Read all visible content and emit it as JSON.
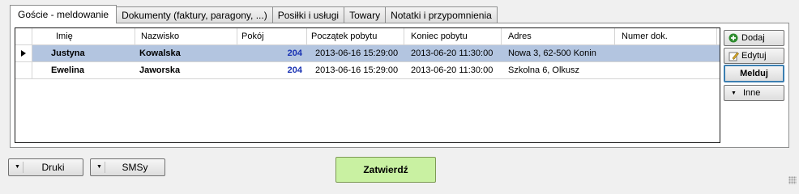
{
  "tabs": [
    {
      "label": "Goście - meldowanie"
    },
    {
      "label": "Dokumenty (faktury, paragony, ...)"
    },
    {
      "label": "Posiłki i usługi"
    },
    {
      "label": "Towary"
    },
    {
      "label": "Notatki i przypomnienia"
    }
  ],
  "active_tab": "Goście - meldowanie",
  "grid": {
    "columns": [
      "Imię",
      "Nazwisko",
      "Pokój",
      "Początek pobytu",
      "Koniec pobytu",
      "Adres",
      "Numer dok."
    ],
    "rows": [
      {
        "imie": "Justyna",
        "nazwisko": "Kowalska",
        "pokoj": "204",
        "start": "2013-06-16 15:29:00",
        "end": "2013-06-20 11:30:00",
        "adres": "Nowa 3, 62-500 Konin",
        "nr": ""
      },
      {
        "imie": "Ewelina",
        "nazwisko": "Jaworska",
        "pokoj": "204",
        "start": "2013-06-16 15:29:00",
        "end": "2013-06-20 11:30:00",
        "adres": "Szkolna 6, Olkusz",
        "nr": ""
      }
    ],
    "selected_row": 0
  },
  "side_buttons": {
    "add": "Dodaj",
    "edit": "Edytuj",
    "checkin": "Melduj",
    "more": "Inne"
  },
  "bottom": {
    "print": "Druki",
    "sms": "SMSy",
    "confirm": "Zatwierdź"
  },
  "colors": {
    "selected_row": "#b3c5e0",
    "room_number": "#1a33b3",
    "confirm_button": "#c9f1a2",
    "focus_border": "#3c7fb1"
  },
  "icons": {
    "add": "plus-circle-icon",
    "edit": "edit-pencil-icon",
    "row_pointer": "triangle-right-icon"
  }
}
